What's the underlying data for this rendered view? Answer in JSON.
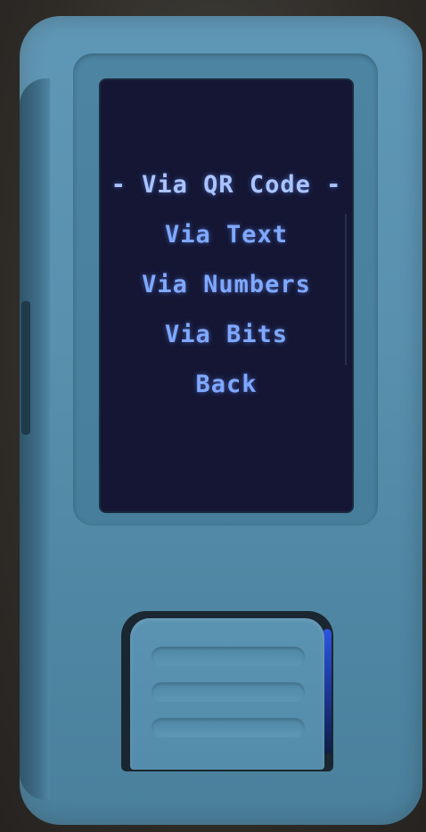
{
  "menu": {
    "items": [
      {
        "label": "Via QR Code",
        "selected": true
      },
      {
        "label": "Via Text",
        "selected": false
      },
      {
        "label": "Via Numbers",
        "selected": false
      },
      {
        "label": "Via Bits",
        "selected": false
      },
      {
        "label": "Back",
        "selected": false
      }
    ],
    "selection_marker_left": "- ",
    "selection_marker_right": " -"
  },
  "colors": {
    "screen_background": "#141634",
    "menu_text": "#7fa8ff",
    "device_body": "#5890ae"
  }
}
